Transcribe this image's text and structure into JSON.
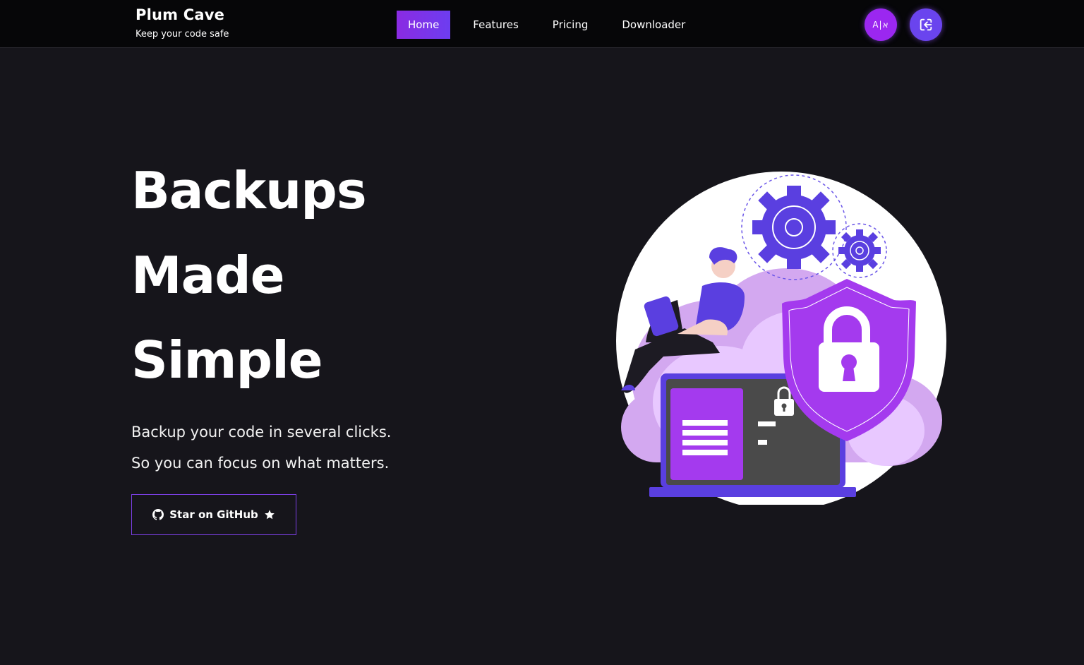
{
  "brand": {
    "title": "Plum Cave",
    "subtitle": "Keep your code safe"
  },
  "nav": {
    "items": [
      {
        "label": "Home",
        "active": true
      },
      {
        "label": "Features",
        "active": false
      },
      {
        "label": "Pricing",
        "active": false
      },
      {
        "label": "Downloader",
        "active": false
      }
    ]
  },
  "header_actions": {
    "language_label": "A|א",
    "language_icon": "translate-icon",
    "login_icon": "login-icon"
  },
  "hero": {
    "title_lines": [
      "Backups",
      "Made",
      "Simple"
    ],
    "subtitle_lines": [
      "Backup your code in several clicks.",
      "So you can focus on what matters."
    ],
    "cta_label": "Star on GitHub",
    "cta_icons": [
      "github-icon",
      "star-icon"
    ]
  },
  "colors": {
    "background": "#16151b",
    "topbar": "#060608",
    "accent_purple": "#9b27f0",
    "accent_indigo": "#6a44ee",
    "illustration_purple": "#5a3fe0"
  },
  "illustration": {
    "icon": "security-backup-illustration"
  }
}
